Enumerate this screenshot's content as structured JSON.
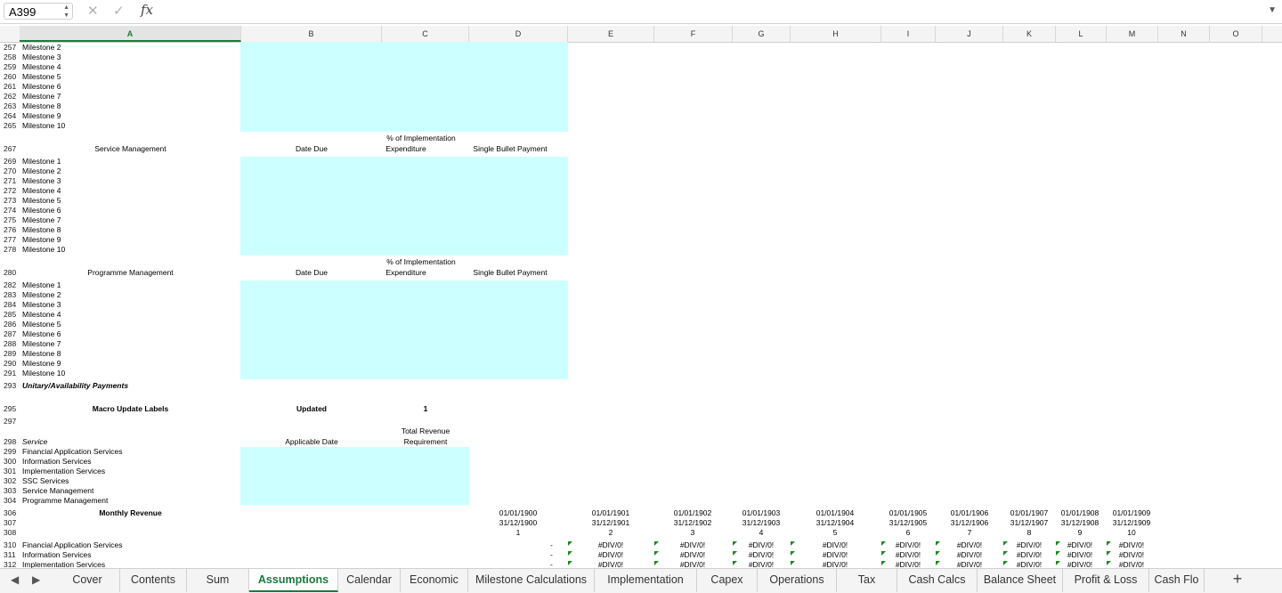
{
  "formula_bar": {
    "cell_ref": "A399",
    "cancel_icon": "✕",
    "enter_icon": "✓",
    "fx_label": "fx",
    "value": ""
  },
  "columns": [
    "A",
    "B",
    "C",
    "D",
    "E",
    "F",
    "G",
    "H",
    "I",
    "J",
    "K",
    "L",
    "M",
    "N",
    "O"
  ],
  "selected_column": "A",
  "milestone_block_1": {
    "rows": [
      {
        "n": "257",
        "label": "Milestone 2"
      },
      {
        "n": "258",
        "label": "Milestone 3"
      },
      {
        "n": "259",
        "label": "Milestone 4"
      },
      {
        "n": "260",
        "label": "Milestone 5"
      },
      {
        "n": "261",
        "label": "Milestone 6"
      },
      {
        "n": "262",
        "label": "Milestone 7"
      },
      {
        "n": "263",
        "label": "Milestone 8"
      },
      {
        "n": "264",
        "label": "Milestone 9"
      },
      {
        "n": "265",
        "label": "Milestone 10"
      }
    ]
  },
  "service_management": {
    "row": "267",
    "title": "Service Management",
    "date_due": "Date Due",
    "pct_line1": "% of Implementation",
    "pct_line2": "Expenditure",
    "single_bullet": "Single Bullet Payment",
    "rows": [
      {
        "n": "269",
        "label": "Milestone 1"
      },
      {
        "n": "270",
        "label": "Milestone 2"
      },
      {
        "n": "271",
        "label": "Milestone 3"
      },
      {
        "n": "272",
        "label": "Milestone 4"
      },
      {
        "n": "273",
        "label": "Milestone 5"
      },
      {
        "n": "274",
        "label": "Milestone 6"
      },
      {
        "n": "275",
        "label": "Milestone 7"
      },
      {
        "n": "276",
        "label": "Milestone 8"
      },
      {
        "n": "277",
        "label": "Milestone 9"
      },
      {
        "n": "278",
        "label": "Milestone 10"
      }
    ]
  },
  "programme_management": {
    "row": "280",
    "title": "Programme Management",
    "date_due": "Date Due",
    "pct_line1": "% of Implementation",
    "pct_line2": "Expenditure",
    "single_bullet": "Single Bullet Payment",
    "rows": [
      {
        "n": "282",
        "label": "Milestone 1"
      },
      {
        "n": "283",
        "label": "Milestone 2"
      },
      {
        "n": "284",
        "label": "Milestone 3"
      },
      {
        "n": "285",
        "label": "Milestone 4"
      },
      {
        "n": "286",
        "label": "Milestone 5"
      },
      {
        "n": "287",
        "label": "Milestone 6"
      },
      {
        "n": "288",
        "label": "Milestone 7"
      },
      {
        "n": "289",
        "label": "Milestone 8"
      },
      {
        "n": "290",
        "label": "Milestone 9"
      },
      {
        "n": "291",
        "label": "Milestone 10"
      }
    ]
  },
  "unitary": {
    "row": "293",
    "label": "Unitary/Availability Payments"
  },
  "macro": {
    "row": "295",
    "label": "Macro Update Labels",
    "updated": "Updated",
    "value": "1"
  },
  "row297": "297",
  "service_table": {
    "row": "298",
    "header": "Service",
    "applicable_date": "Applicable Date",
    "trr_line1": "Total Revenue",
    "trr_line2": "Requirement",
    "rows": [
      {
        "n": "299",
        "label": "Financial Application Services"
      },
      {
        "n": "300",
        "label": "Information Services"
      },
      {
        "n": "301",
        "label": "Implementation Services"
      },
      {
        "n": "302",
        "label": "SSC Services"
      },
      {
        "n": "303",
        "label": "Service Management"
      },
      {
        "n": "304",
        "label": "Programme Management"
      }
    ]
  },
  "monthly_revenue": {
    "label": "Monthly Revenue",
    "row_numbers": [
      "306",
      "307",
      "308"
    ],
    "periods": [
      {
        "start": "01/01/1900",
        "end": "31/12/1900",
        "idx": "1"
      },
      {
        "start": "01/01/1901",
        "end": "31/12/1901",
        "idx": "2"
      },
      {
        "start": "01/01/1902",
        "end": "31/12/1902",
        "idx": "3"
      },
      {
        "start": "01/01/1903",
        "end": "31/12/1903",
        "idx": "4"
      },
      {
        "start": "01/01/1904",
        "end": "31/12/1904",
        "idx": "5"
      },
      {
        "start": "01/01/1905",
        "end": "31/12/1905",
        "idx": "6"
      },
      {
        "start": "01/01/1906",
        "end": "31/12/1906",
        "idx": "7"
      },
      {
        "start": "01/01/1907",
        "end": "31/12/1907",
        "idx": "8"
      },
      {
        "start": "01/01/1908",
        "end": "31/12/1908",
        "idx": "9"
      },
      {
        "start": "01/01/1909",
        "end": "31/12/1909",
        "idx": "10"
      }
    ],
    "rows": [
      {
        "n": "310",
        "label": "Financial Application Services"
      },
      {
        "n": "311",
        "label": "Information Services"
      },
      {
        "n": "312",
        "label": "Implementation Services"
      }
    ],
    "dash": "-",
    "error": "#DIV/0!"
  },
  "sheet_tabs": {
    "items": [
      "Cover",
      "Contents",
      "Sum",
      "Assumptions",
      "Calendar",
      "Economic",
      "Milestone Calculations",
      "Implementation",
      "Capex",
      "Operations",
      "Tax",
      "Cash Calcs",
      "Balance Sheet",
      "Profit & Loss",
      "Cash Flo"
    ],
    "active": "Assumptions",
    "add": "+",
    "prev_icon": "◀",
    "next_icon": "▶"
  },
  "colors": {
    "fill": "#ccffff",
    "accent": "#1a7a3c",
    "error_flag": "#1a8a1a"
  }
}
